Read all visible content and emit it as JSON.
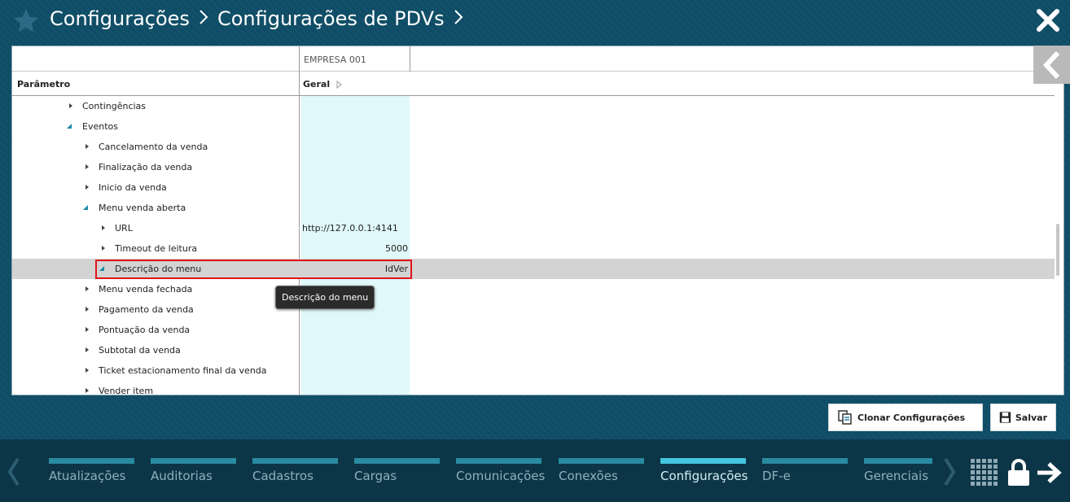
{
  "header": {
    "breadcrumb": [
      "Configurações",
      "Configurações de PDVs"
    ]
  },
  "grid": {
    "company_header": "EMPRESA 001",
    "param_header": "Parâmetro",
    "geral_header": "Geral",
    "rows": [
      {
        "label": "Contingências",
        "value": ""
      },
      {
        "label": "Eventos",
        "value": ""
      },
      {
        "label": "Cancelamento da venda",
        "value": ""
      },
      {
        "label": "Finalização da venda",
        "value": ""
      },
      {
        "label": "Inicio da venda",
        "value": ""
      },
      {
        "label": "Menu venda aberta",
        "value": ""
      },
      {
        "label": "URL",
        "value": "http://127.0.0.1:4141"
      },
      {
        "label": "Timeout de leitura",
        "value": "5000"
      },
      {
        "label": "Descrição do menu",
        "value": "IdVer"
      },
      {
        "label": "Menu venda fechada",
        "value": ""
      },
      {
        "label": "Pagamento da venda",
        "value": ""
      },
      {
        "label": "Pontuação da venda",
        "value": ""
      },
      {
        "label": "Subtotal da venda",
        "value": ""
      },
      {
        "label": "Ticket estacionamento final da venda",
        "value": ""
      },
      {
        "label": "Vender item",
        "value": ""
      }
    ],
    "tooltip": "Descrição do menu"
  },
  "actions": {
    "clone_label": "Clonar Configurações",
    "save_label": "Salvar"
  },
  "nav": {
    "items": [
      {
        "label": "Atualizações"
      },
      {
        "label": "Auditorias"
      },
      {
        "label": "Cadastros"
      },
      {
        "label": "Cargas"
      },
      {
        "label": "Comunicações"
      },
      {
        "label": "Conexões"
      },
      {
        "label": "Configurações"
      },
      {
        "label": "DF-e"
      },
      {
        "label": "Gerenciais"
      }
    ],
    "active": "Configurações"
  },
  "colors": {
    "background": "#0f4d66",
    "bottom_bar": "#0c3647",
    "value_column": "#e0f8f9",
    "selected_row": "#d3d3d3",
    "highlight_border": "#e0131a",
    "nav_bar": "#2a8aa0",
    "nav_bar_active": "#45c6de"
  }
}
